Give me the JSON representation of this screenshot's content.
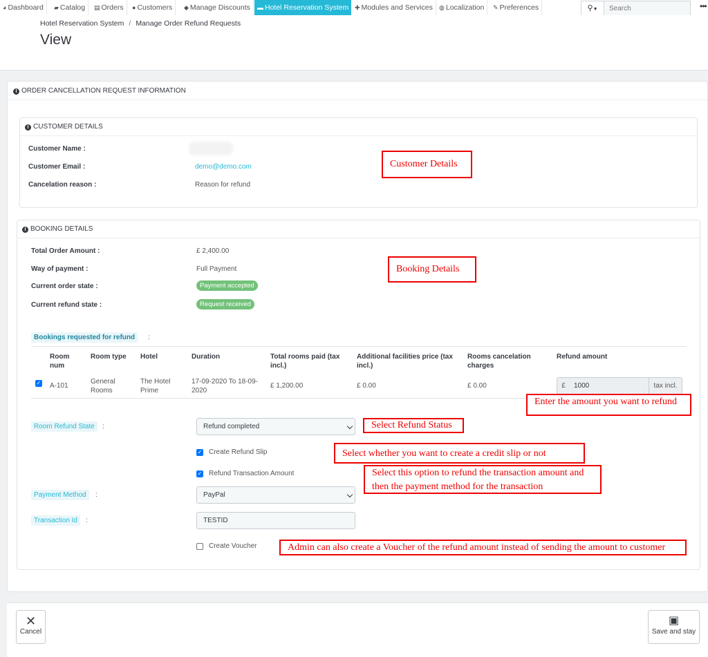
{
  "nav": {
    "items": [
      {
        "icon": "dashboard-icon",
        "label": "Dashboard"
      },
      {
        "icon": "catalog-icon",
        "label": "Catalog"
      },
      {
        "icon": "orders-icon",
        "label": "Orders"
      },
      {
        "icon": "customers-icon",
        "label": "Customers"
      },
      {
        "icon": "discounts-icon",
        "label": "Manage Discounts"
      },
      {
        "icon": "bed-icon",
        "label": "Hotel Reservation System"
      },
      {
        "icon": "puzzle-icon",
        "label": "Modules and Services"
      },
      {
        "icon": "globe-icon",
        "label": "Localization"
      },
      {
        "icon": "wrench-icon",
        "label": "Preferences"
      }
    ],
    "active_index": 5,
    "search_placeholder": "Search"
  },
  "header": {
    "breadcrumb": [
      "Hotel Reservation System",
      "Manage Order Refund Requests"
    ],
    "title": "View"
  },
  "main": {
    "panel_title": "ORDER CANCELLATION REQUEST INFORMATION",
    "customer": {
      "title": "CUSTOMER DETAILS",
      "name_label": "Customer Name :",
      "email_label": "Customer Email :",
      "email": "demo@demo.com",
      "reason_label": "Cancelation reason :",
      "reason": "Reason for refund"
    },
    "booking": {
      "title": "BOOKING DETAILS",
      "total_label": "Total Order Amount :",
      "total": "£ 2,400.00",
      "payment_label": "Way of payment :",
      "payment": "Full Payment",
      "order_state_label": "Current order state :",
      "order_state": "Payment accepted",
      "refund_state_label": "Current refund state :",
      "refund_state": "Request received",
      "status_color": "#72c279",
      "bookings_label": "Bookings requested for refund",
      "colon": ":",
      "columns": [
        "Room num",
        "Room type",
        "Hotel",
        "Duration",
        "Total rooms paid (tax incl.)",
        "Additional facilities price (tax incl.)",
        "Rooms cancelation charges",
        "Refund amount"
      ],
      "rows": [
        {
          "room_num": "A-101",
          "room_type": "General Rooms",
          "hotel": "The Hotel Prime",
          "duration": "17-09-2020 To 18-09-2020",
          "total_paid": "£ 1,200.00",
          "facilities": "£ 0.00",
          "cancel_charges": "£ 0.00",
          "currency": "£",
          "refund_amount": "1000",
          "tax_suffix": "tax incl."
        }
      ]
    },
    "form": {
      "refund_state_label": "Room Refund State",
      "refund_state_value": "Refund completed",
      "create_slip_label": "Create Refund Slip",
      "refund_txn_label": "Refund Transaction Amount",
      "payment_method_label": "Payment Method",
      "payment_method_value": "PayPal",
      "txn_id_label": "Transaction Id",
      "txn_id_value": "TESTID",
      "voucher_label": "Create Voucher"
    }
  },
  "annotations": {
    "customer": "Customer Details",
    "booking": "Booking Details",
    "amount": "Enter the amount you want to refund",
    "status": "Select Refund Status",
    "slip": "Select whether you want to create a credit slip or not",
    "txn": "Select this option to refund the transaction amount and then the payment method for the transaction",
    "voucher": "Admin can also create a Voucher of the refund amount instead of sending the amount to customer",
    "color": "#ee0000"
  },
  "footer": {
    "cancel": "Cancel",
    "save": "Save and stay"
  }
}
